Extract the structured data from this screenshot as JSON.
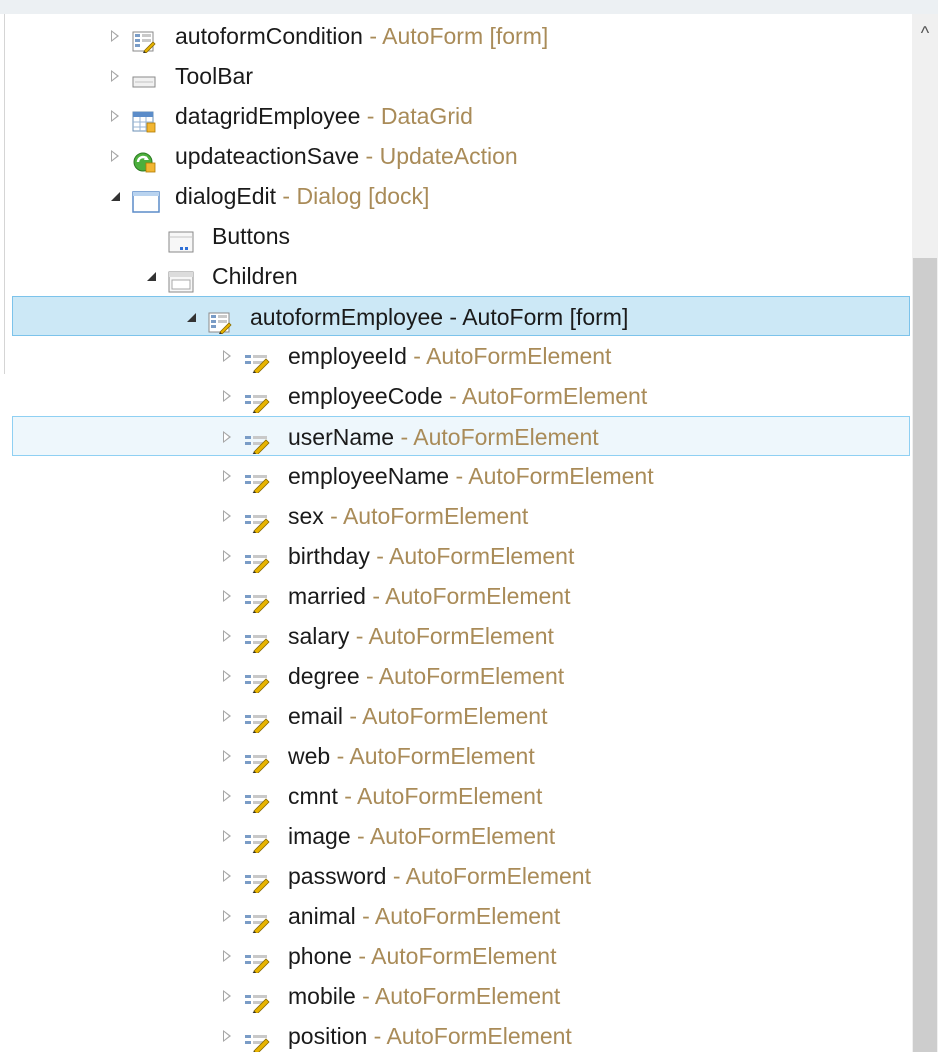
{
  "scrollbar": {
    "up_arrow": "^"
  },
  "rows": [
    {
      "name": "autoformCondition",
      "type": " - AutoForm [form]",
      "indent": 0,
      "twisty": "closed",
      "icon": "autoform-icon",
      "state": ""
    },
    {
      "name": "ToolBar",
      "type": "",
      "indent": 0,
      "twisty": "closed",
      "icon": "toolbar-icon",
      "state": ""
    },
    {
      "name": "datagridEmployee",
      "type": " - DataGrid",
      "indent": 0,
      "twisty": "closed",
      "icon": "datagrid-icon",
      "state": ""
    },
    {
      "name": "updateactionSave",
      "type": " - UpdateAction",
      "indent": 0,
      "twisty": "closed",
      "icon": "updateaction-icon",
      "state": ""
    },
    {
      "name": "dialogEdit",
      "type": " - Dialog [dock]",
      "indent": 0,
      "twisty": "open",
      "icon": "dialog-icon",
      "state": ""
    },
    {
      "name": "Buttons",
      "type": "",
      "indent": 1,
      "twisty": "none",
      "icon": "buttons-icon",
      "state": ""
    },
    {
      "name": "Children",
      "type": "",
      "indent": 1,
      "twisty": "open",
      "icon": "children-icon",
      "state": ""
    },
    {
      "name": "autoformEmployee",
      "type": " - AutoForm [form]",
      "indent": 2,
      "twisty": "open",
      "icon": "autoform-icon",
      "state": "selected"
    },
    {
      "name": "employeeId",
      "type": " - AutoFormElement",
      "indent": 3,
      "twisty": "closed",
      "icon": "formelement-icon",
      "state": ""
    },
    {
      "name": "employeeCode",
      "type": " - AutoFormElement",
      "indent": 3,
      "twisty": "closed",
      "icon": "formelement-icon",
      "state": ""
    },
    {
      "name": "userName",
      "type": " - AutoFormElement",
      "indent": 3,
      "twisty": "closed",
      "icon": "formelement-icon",
      "state": "hover"
    },
    {
      "name": "employeeName",
      "type": " - AutoFormElement",
      "indent": 3,
      "twisty": "closed",
      "icon": "formelement-icon",
      "state": ""
    },
    {
      "name": "sex",
      "type": " - AutoFormElement",
      "indent": 3,
      "twisty": "closed",
      "icon": "formelement-icon",
      "state": ""
    },
    {
      "name": "birthday",
      "type": " - AutoFormElement",
      "indent": 3,
      "twisty": "closed",
      "icon": "formelement-icon",
      "state": ""
    },
    {
      "name": "married",
      "type": " - AutoFormElement",
      "indent": 3,
      "twisty": "closed",
      "icon": "formelement-icon",
      "state": ""
    },
    {
      "name": "salary",
      "type": " - AutoFormElement",
      "indent": 3,
      "twisty": "closed",
      "icon": "formelement-icon",
      "state": ""
    },
    {
      "name": "degree",
      "type": " - AutoFormElement",
      "indent": 3,
      "twisty": "closed",
      "icon": "formelement-icon",
      "state": ""
    },
    {
      "name": "email",
      "type": " - AutoFormElement",
      "indent": 3,
      "twisty": "closed",
      "icon": "formelement-icon",
      "state": ""
    },
    {
      "name": "web",
      "type": " - AutoFormElement",
      "indent": 3,
      "twisty": "closed",
      "icon": "formelement-icon",
      "state": ""
    },
    {
      "name": "cmnt",
      "type": " - AutoFormElement",
      "indent": 3,
      "twisty": "closed",
      "icon": "formelement-icon",
      "state": ""
    },
    {
      "name": "image",
      "type": " - AutoFormElement",
      "indent": 3,
      "twisty": "closed",
      "icon": "formelement-icon",
      "state": ""
    },
    {
      "name": "password",
      "type": " - AutoFormElement",
      "indent": 3,
      "twisty": "closed",
      "icon": "formelement-icon",
      "state": ""
    },
    {
      "name": "animal",
      "type": " - AutoFormElement",
      "indent": 3,
      "twisty": "closed",
      "icon": "formelement-icon",
      "state": ""
    },
    {
      "name": "phone",
      "type": " - AutoFormElement",
      "indent": 3,
      "twisty": "closed",
      "icon": "formelement-icon",
      "state": ""
    },
    {
      "name": "mobile",
      "type": " - AutoFormElement",
      "indent": 3,
      "twisty": "closed",
      "icon": "formelement-icon",
      "state": ""
    },
    {
      "name": "position",
      "type": " - AutoFormElement",
      "indent": 3,
      "twisty": "closed",
      "icon": "formelement-icon",
      "state": ""
    }
  ]
}
